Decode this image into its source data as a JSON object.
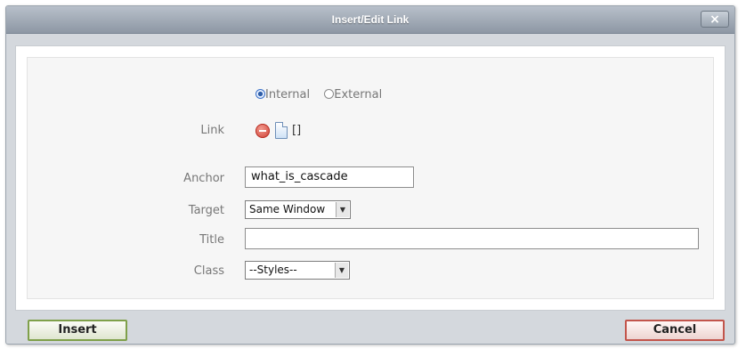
{
  "dialog": {
    "title": "Insert/Edit Link",
    "close_label": "×"
  },
  "link_type": {
    "options": [
      "Internal",
      "External"
    ],
    "selected": "Internal"
  },
  "form": {
    "link_label": "Link",
    "link_value": "[]",
    "anchor_label": "Anchor",
    "anchor_value": "what_is_cascade",
    "target_label": "Target",
    "target_value": "Same Window",
    "title_label": "Title",
    "title_value": "",
    "class_label": "Class",
    "class_value": "--Styles--"
  },
  "icons": {
    "remove": "remove-icon",
    "page": "page-icon",
    "dropdown": "chevron-down-icon",
    "close": "close-icon"
  },
  "buttons": {
    "insert_label": "Insert",
    "cancel_label": "Cancel"
  },
  "colors": {
    "title_bar": "#9aa4b0",
    "insert_border": "#7fa04a",
    "cancel_border": "#c2554c"
  }
}
